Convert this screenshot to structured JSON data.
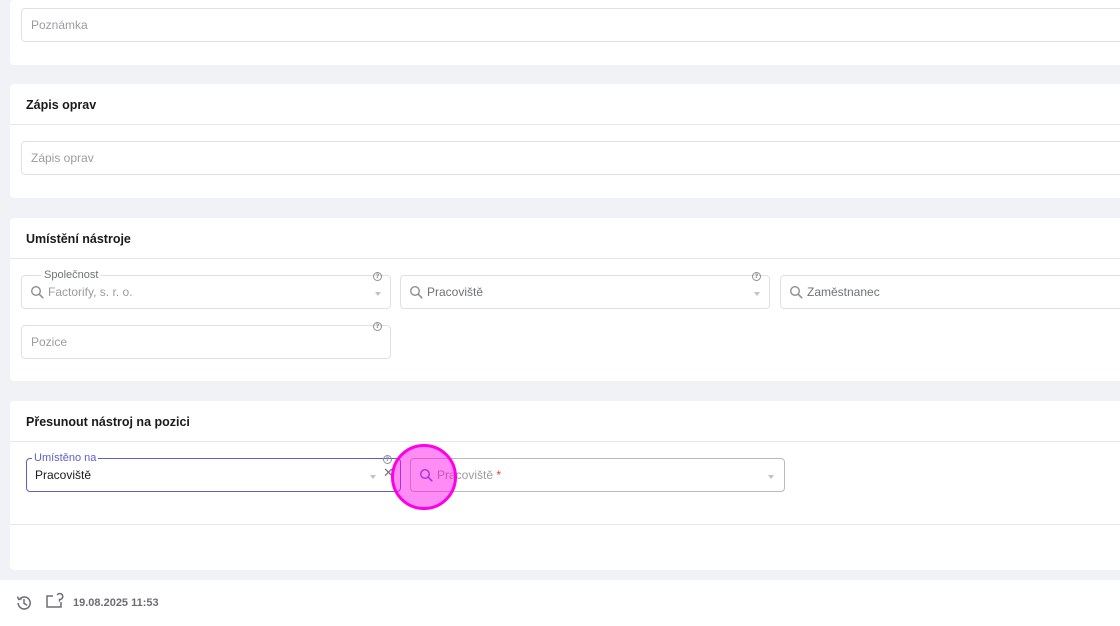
{
  "note_card": {
    "note_placeholder": "Poznámka"
  },
  "repairs_card": {
    "title": "Zápis oprav",
    "repairs_placeholder": "Zápis oprav"
  },
  "location_card": {
    "title": "Umístění nástroje",
    "company_label": "Společnost",
    "company_placeholder": "Factorify, s. r. o.",
    "workplace_placeholder": "Pracoviště",
    "employee_placeholder": "Zaměstnanec",
    "position_placeholder": "Pozice",
    "help_glyph": "?"
  },
  "move_card": {
    "title": "Přesunout nástroj na pozici",
    "placed_on_label": "Umístěno na",
    "placed_on_value": "Pracoviště",
    "workplace_placeholder": "Pracoviště",
    "required_mark": "*",
    "clear_glyph": "✕",
    "accent": "#5b5fc7",
    "required_color": "#e53935"
  },
  "footer": {
    "timestamp": "19.08.2025 11:53"
  },
  "cursor_highlight_color": "#ff00e6"
}
